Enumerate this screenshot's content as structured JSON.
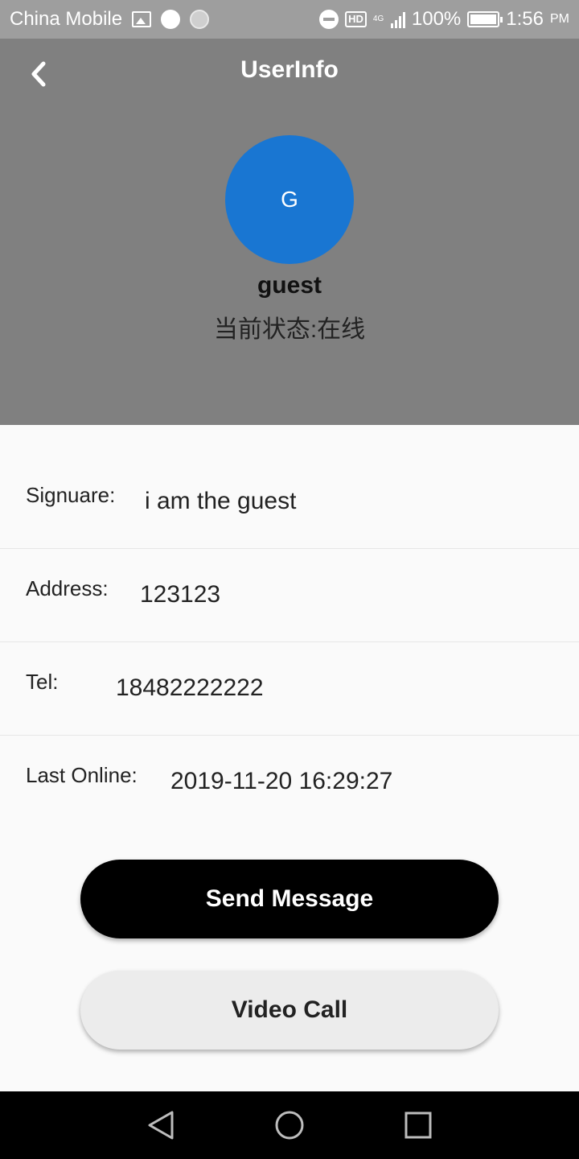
{
  "status_bar": {
    "carrier": "China Mobile",
    "network": "4G",
    "hd_label": "HD",
    "battery": "100%",
    "time": "1:56",
    "ampm": "PM"
  },
  "header": {
    "title": "UserInfo",
    "avatar_letter": "G",
    "username": "guest",
    "status": "当前状态:在线",
    "colors": {
      "background": "#808080",
      "avatar": "#1976d2"
    }
  },
  "info": {
    "signature_label": "Signuare:",
    "signature_value": "i am the guest",
    "address_label": "Address:",
    "address_value": "123123",
    "tel_label": "Tel:",
    "tel_value": "18482222222",
    "last_online_label": "Last Online:",
    "last_online_value": "2019-11-20 16:29:27"
  },
  "actions": {
    "send_message": "Send Message",
    "video_call": "Video Call"
  },
  "icons": {
    "back": "chevron-left-icon",
    "nav_back": "triangle-back-icon",
    "nav_home": "circle-home-icon",
    "nav_recents": "square-recents-icon"
  }
}
